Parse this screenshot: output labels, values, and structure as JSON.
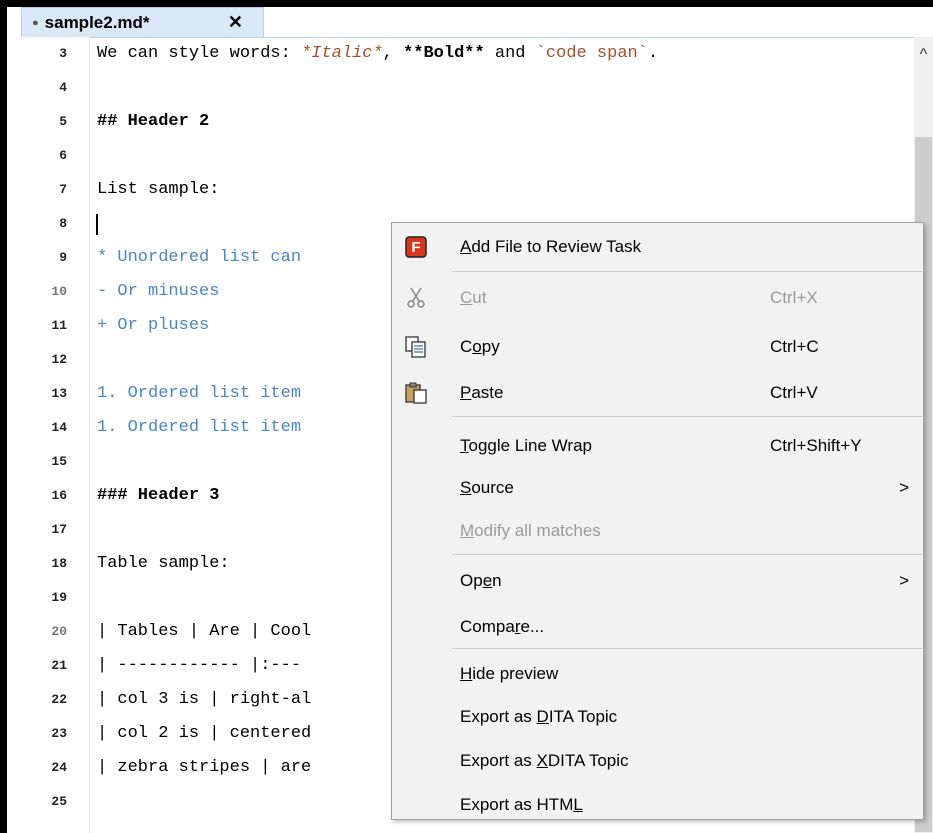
{
  "tab": {
    "title": "sample2.md*",
    "dot": "●",
    "close": "✕"
  },
  "gutter": [
    "3",
    "4",
    "5",
    "6",
    "7",
    "8",
    "9",
    "10",
    "11",
    "12",
    "13",
    "14",
    "15",
    "16",
    "17",
    "18",
    "19",
    "20",
    "21",
    "22",
    "23",
    "24",
    "25"
  ],
  "code": {
    "l3_a": "We can style words: ",
    "l3_italic": "*Italic*",
    "l3_b": ", ",
    "l3_bold": "**Bold**",
    "l3_c": " and ",
    "l3_code": "`code span`",
    "l3_d": ".",
    "l5": "## Header 2",
    "l7": "List sample:",
    "l9": "* Unordered list can",
    "l10": "- Or minuses",
    "l11": "+ Or pluses",
    "l13": "1. Ordered list item",
    "l14": "1. Ordered list item",
    "l16": "### Header 3",
    "l18": "Table sample:",
    "l20": "| Tables | Are | Cool",
    "l21": "| ------------ |:---",
    "l22": "| col 3 is | right-al",
    "l23": "| col 2 is | centered",
    "l24": "| zebra stripes | are"
  },
  "scrollbar": {
    "up_arrow": "^"
  },
  "menu": {
    "review": {
      "pre": "",
      "u": "A",
      "post": "dd File to Review Task",
      "icon": "F",
      "icon_color": "#d9381e"
    },
    "cut": {
      "pre": "",
      "u": "C",
      "post": "ut",
      "shortcut": "Ctrl+X"
    },
    "copy": {
      "pre": "C",
      "u": "o",
      "post": "py",
      "shortcut": "Ctrl+C"
    },
    "paste": {
      "pre": "",
      "u": "P",
      "post": "aste",
      "shortcut": "Ctrl+V"
    },
    "toggle": {
      "pre": "",
      "u": "T",
      "post": "oggle Line Wrap",
      "shortcut": "Ctrl+Shift+Y"
    },
    "source": {
      "pre": "",
      "u": "S",
      "post": "ource",
      "arrow": ">"
    },
    "modify": {
      "pre": "",
      "u": "M",
      "post": "odify all matches"
    },
    "open": {
      "pre": "Op",
      "u": "e",
      "post": "n",
      "arrow": ">"
    },
    "compare": {
      "pre": "Compa",
      "u": "r",
      "post": "e..."
    },
    "hide": {
      "pre": "",
      "u": "H",
      "post": "ide preview"
    },
    "dita": {
      "pre": "Export as ",
      "u": "D",
      "post": "ITA Topic"
    },
    "xdita": {
      "pre": "Export as ",
      "u": "X",
      "post": "DITA Topic"
    },
    "html": {
      "pre": "Export as HTM",
      "u": "L",
      "post": ""
    }
  }
}
